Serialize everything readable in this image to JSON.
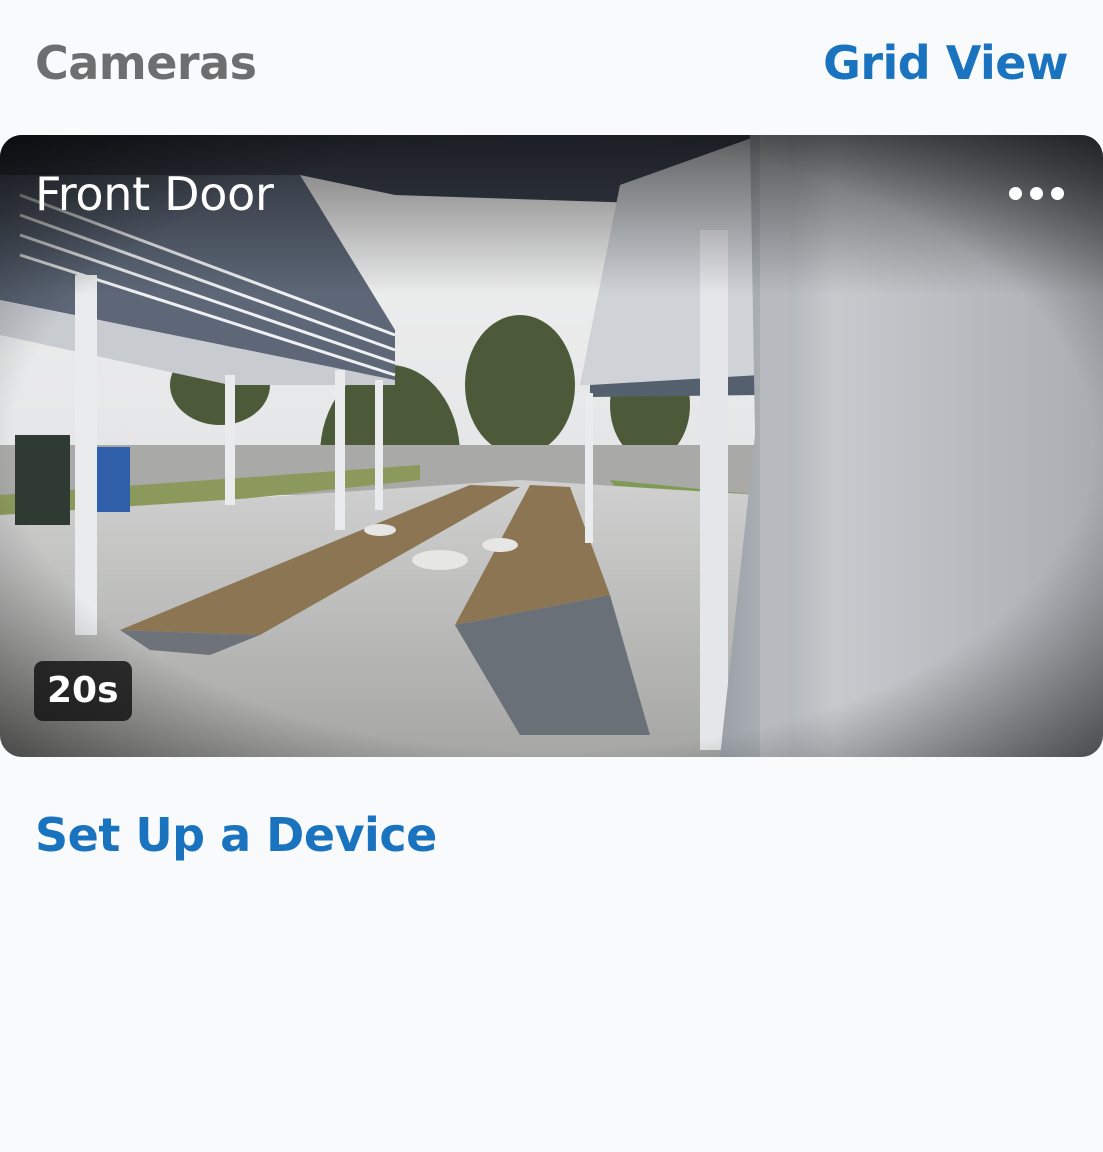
{
  "header": {
    "title": "Cameras",
    "grid_view_label": "Grid View"
  },
  "camera": {
    "name": "Front Door",
    "age_label": "20s",
    "more_icon": "more-horizontal-icon"
  },
  "footer": {
    "setup_label": "Set Up a Device"
  },
  "colors": {
    "accent": "#1a73bf",
    "muted_title": "#6e6e6e",
    "background": "#f8fafc"
  }
}
